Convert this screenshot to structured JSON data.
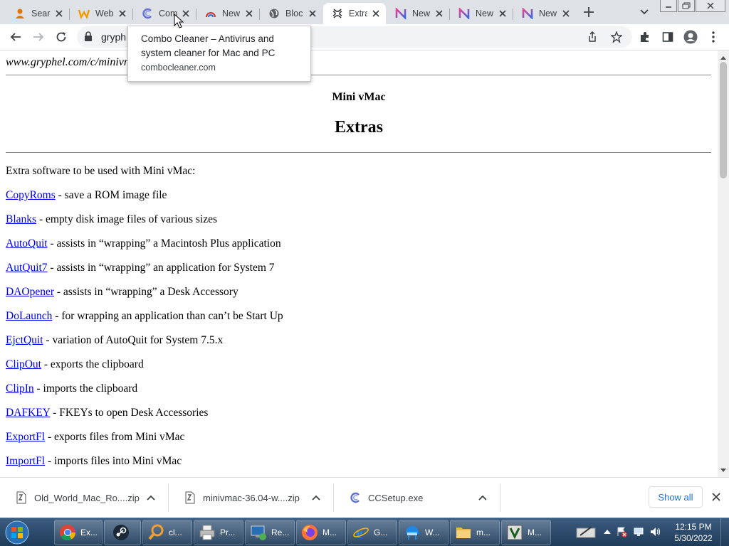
{
  "browser": {
    "tabs": [
      {
        "title": "Sear",
        "icon": "magnifier-person-icon",
        "color": "#e37400"
      },
      {
        "title": "Web",
        "icon": "w-shield-icon",
        "color": "#f29900"
      },
      {
        "title": "Com",
        "icon": "combo-cleaner-icon",
        "color": "#5f6fd1"
      },
      {
        "title": "New",
        "icon": "rainbow-arc-icon",
        "color": "#d93025"
      },
      {
        "title": "Bloc",
        "icon": "globe-icon",
        "color": "#5f6368"
      },
      {
        "title": "Extra",
        "icon": "mini-vmac-icon",
        "color": "#202124"
      },
      {
        "title": "New",
        "icon": "nw-gradient-icon",
        "color": "#8e44ad"
      },
      {
        "title": "New",
        "icon": "nw-gradient-icon",
        "color": "#8e44ad"
      },
      {
        "title": "New",
        "icon": "nw-gradient-icon",
        "color": "#8e44ad"
      }
    ],
    "address": "gryph",
    "tooltip": {
      "title": "Combo Cleaner – Antivirus and system cleaner for Mac and PC",
      "domain": "combocleaner.com"
    }
  },
  "page": {
    "breadcrumb": {
      "site": "www.gryphel.com",
      "sep": "/c/",
      "section": "minivn"
    },
    "site_title": "Mini vMac",
    "title": "Extras",
    "intro": "Extra software to be used with Mini vMac:",
    "items": [
      {
        "link": "CopyRoms",
        "desc": " - save a ROM image file"
      },
      {
        "link": "Blanks",
        "desc": " - empty disk image files of various sizes"
      },
      {
        "link": "AutoQuit",
        "desc": " - assists in “wrapping” a Macintosh Plus application"
      },
      {
        "link": "AutQuit7",
        "desc": " - assists in “wrapping” an application for System 7"
      },
      {
        "link": "DAOpener",
        "desc": " - assists in “wrapping” a Desk Accessory"
      },
      {
        "link": "DoLaunch",
        "desc": " - for wrapping an application than can’t be Start Up"
      },
      {
        "link": "EjctQuit",
        "desc": " - variation of AutoQuit for System 7.5.x"
      },
      {
        "link": "ClipOut",
        "desc": " - exports the clipboard"
      },
      {
        "link": "ClipIn",
        "desc": " - imports the clipboard"
      },
      {
        "link": "DAFKEY",
        "desc": " - FKEYs to open Desk Accessories"
      },
      {
        "link": "ExportFl",
        "desc": " - exports files from Mini vMac"
      },
      {
        "link": "ImportFl",
        "desc": " - imports files into Mini vMac"
      }
    ]
  },
  "downloads": {
    "items": [
      {
        "name": "Old_World_Mac_Ro....zip",
        "icon": "zip-file-icon"
      },
      {
        "name": "minivmac-36.04-w....zip",
        "icon": "zip-file-icon"
      },
      {
        "name": "CCSetup.exe",
        "icon": "combo-cleaner-icon"
      }
    ],
    "show_all": "Show all"
  },
  "taskbar": {
    "buttons": [
      {
        "label": "Ex...",
        "icon": "chrome-icon"
      },
      {
        "label": "",
        "icon": "steam-icon"
      },
      {
        "label": "cl...",
        "icon": "magnifier-icon"
      },
      {
        "label": "Pr...",
        "icon": "printer-icon"
      },
      {
        "label": "Re...",
        "icon": "remote-desktop-icon"
      },
      {
        "label": "M...",
        "icon": "firefox-icon"
      },
      {
        "label": "G...",
        "icon": "internet-explorer-icon"
      },
      {
        "label": "W...",
        "icon": "helmet-icon"
      },
      {
        "label": "m...",
        "icon": "folder-icon"
      },
      {
        "label": "M...",
        "icon": "vim-icon"
      }
    ],
    "time": "12:15 PM",
    "date": "5/30/2022"
  },
  "colors": {
    "link": "#0000ee",
    "accent": "#1a73e8",
    "taskbar": "#2b4a6b"
  }
}
